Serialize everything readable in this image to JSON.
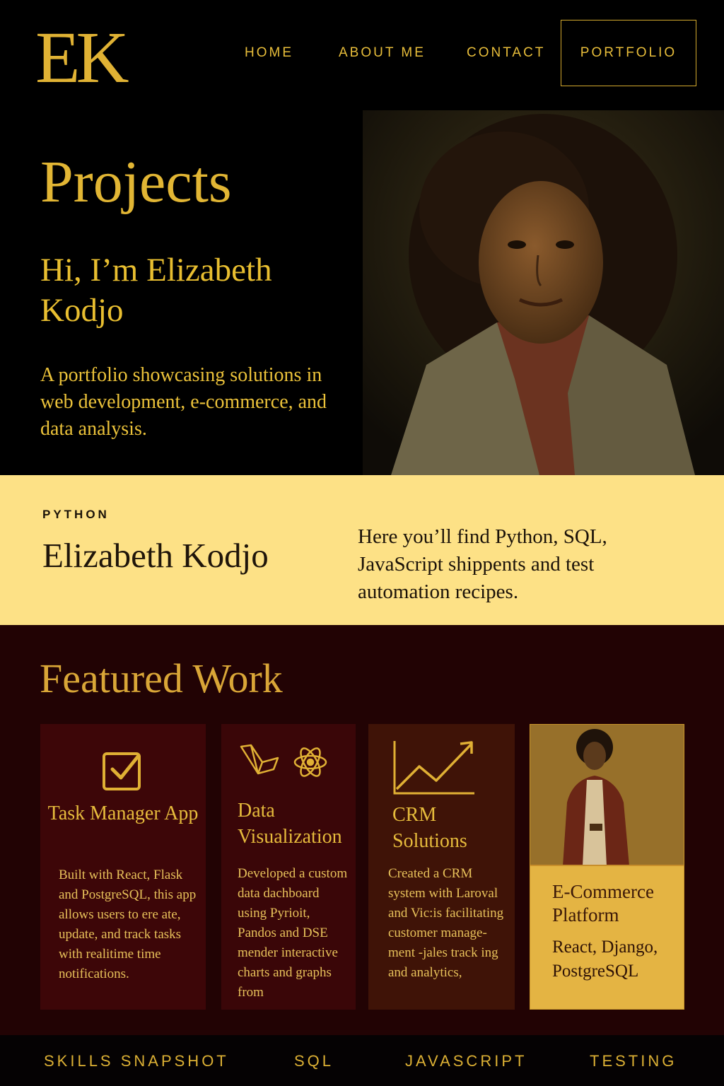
{
  "header": {
    "logo": "EK",
    "nav": [
      "HOME",
      "ABOUT ME",
      "CONTACT",
      "PORTFOLIO"
    ]
  },
  "hero": {
    "title": "Projects",
    "greeting": "Hi, I’m Elizabeth Kodjo",
    "description": "A portfolio showcasing solutions in web development, e-commerce, and data analysis."
  },
  "banner": {
    "tag": "PYTHON",
    "name": "Elizabeth Kodjo",
    "text": "Here you’ll find Python, SQL, JavaScript shippents and test automation recipes."
  },
  "featured": {
    "title": "Featured Work",
    "cards": [
      {
        "title": "Task Manager App",
        "description": "Built with React, Flask and PostgreSQL, this app allows users to ere ate, update, and track tasks with realitime time notifications.",
        "icon": "checkbox-icon"
      },
      {
        "title": "Data Visualization",
        "description": "Developed a custom data dachboard using Pyrioit, Pandos and DSE mender interactive charts and graphs from",
        "icon": "laravel-react-icons"
      },
      {
        "title": "CRM Solutions",
        "description": "Created a CRM system with Laroval and Vic:is facilitating customer manage- ment -jales track ing and analytics,",
        "icon": "line-chart-icon"
      },
      {
        "title": "E-Commerce Platform",
        "description": "React, Django, PostgreSQL"
      }
    ]
  },
  "footer": {
    "items": [
      "SKILLS SNAPSHOT",
      "SQL",
      "JAVASCRIPT",
      "TESTING"
    ]
  },
  "colors": {
    "gold": "#e2b634",
    "banner": "#fde186",
    "maroon": "#220304"
  }
}
